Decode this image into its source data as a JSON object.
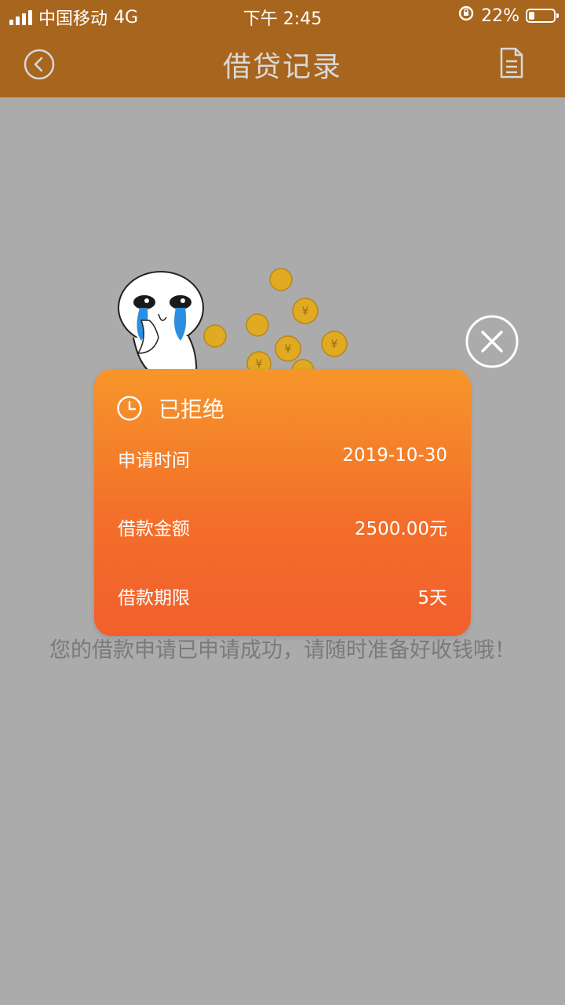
{
  "status_bar": {
    "carrier": "中国移动",
    "network": "4G",
    "time": "下午 2:45",
    "battery": "22%",
    "battery_level": 0.22
  },
  "nav": {
    "title": "借贷记录",
    "back_icon": "chevron-left-circle-icon",
    "doc_icon": "document-icon"
  },
  "card": {
    "status": "已拒绝",
    "status_icon": "clock-icon",
    "rows": [
      {
        "label": "申请时间",
        "value": "2019-10-30"
      },
      {
        "label": "借款金额",
        "value": "2500.00元"
      },
      {
        "label": "借款期限",
        "value": "5天"
      }
    ]
  },
  "message": "您的借款申请已申请成功，请随时准备好收钱哦！",
  "colors": {
    "header": "#a8651e",
    "overlay_bg": "#ababab",
    "card_top": "#f6962a",
    "card_bottom": "#f25f2c",
    "coin": "#e0ab22"
  }
}
